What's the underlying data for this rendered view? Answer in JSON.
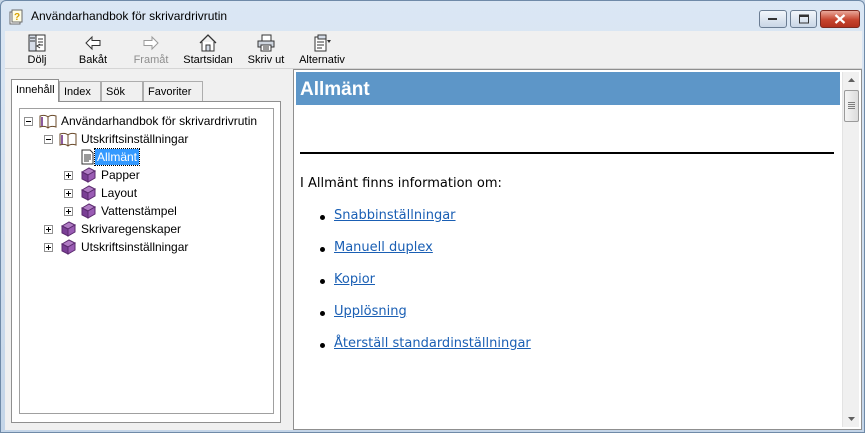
{
  "window": {
    "title": "Användarhandbok för skrivardrivrutin",
    "controls": {
      "minimize": "minimize",
      "maximize": "maximize",
      "close": "close"
    }
  },
  "toolbar": {
    "buttons": [
      {
        "label": "Dölj",
        "icon": "hide-pane-icon",
        "enabled": true
      },
      {
        "label": "Bakåt",
        "icon": "back-arrow-icon",
        "enabled": true
      },
      {
        "label": "Framåt",
        "icon": "forward-arrow-icon",
        "enabled": false
      },
      {
        "label": "Startsidan",
        "icon": "home-icon",
        "enabled": true
      },
      {
        "label": "Skriv ut",
        "icon": "printer-icon",
        "enabled": true
      },
      {
        "label": "Alternativ",
        "icon": "options-icon",
        "enabled": true
      }
    ]
  },
  "left_pane": {
    "tabs": [
      {
        "label": "Innehåll",
        "active": true
      },
      {
        "label": "Index",
        "active": false
      },
      {
        "label": "Sök",
        "active": false
      },
      {
        "label": "Favoriter",
        "active": false
      }
    ],
    "tree": [
      {
        "label": "Användarhandbok för skrivardrivrutin",
        "expanded": true,
        "icon": "open-book-icon"
      },
      {
        "label": "Utskriftsinställningar",
        "expanded": true,
        "icon": "open-book-icon"
      },
      {
        "label": "Allmänt",
        "selected": true,
        "icon": "page-icon"
      },
      {
        "label": "Papper",
        "expanded": false,
        "icon": "closed-book-icon"
      },
      {
        "label": "Layout",
        "expanded": false,
        "icon": "closed-book-icon"
      },
      {
        "label": "Vattenstämpel",
        "expanded": false,
        "icon": "closed-book-icon"
      },
      {
        "label": "Skrivaregenskaper",
        "expanded": false,
        "icon": "closed-book-icon"
      },
      {
        "label": "Utskriftsinställningar",
        "expanded": false,
        "icon": "closed-book-icon"
      }
    ]
  },
  "topic": {
    "title": "Allmänt",
    "intro": "I Allmänt finns information om:",
    "links": [
      "Snabbinställningar",
      "Manuell duplex",
      "Kopior",
      "Upplösning",
      "Återställ standardinställningar"
    ]
  },
  "colors": {
    "header_bar": "#5d96c8",
    "link": "#1a5fb4",
    "selection": "#3399ff"
  }
}
